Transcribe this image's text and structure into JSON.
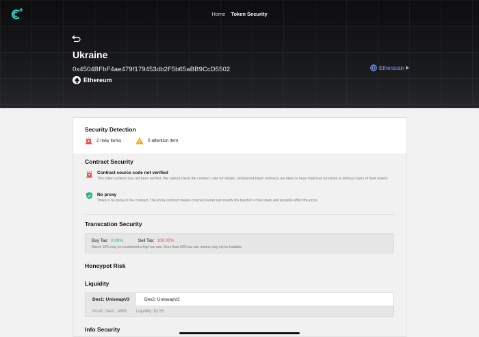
{
  "nav": {
    "home": "Home",
    "token_security": "Token Security"
  },
  "token": {
    "name": "Ukraine",
    "address": "0x4504BFbF4ae479f179453db2F5b65aBB9CcD5502",
    "chain": "Ethereum",
    "explorer_link": "Etherscan"
  },
  "security_detection": {
    "title": "Security Detection",
    "risky": "2 risky items",
    "attention": "0 attention item"
  },
  "contract_security": {
    "title": "Contract Security",
    "items": [
      {
        "title": "Contract source code not verified",
        "desc": "This token contract has not been verified. We cannot check the contract code for details. Unsourced token contracts are likely to have malicious functions to defraud users of their assets.",
        "status": "risky"
      },
      {
        "title": "No proxy",
        "desc": "There is no proxy in the contract. The proxy contract means contract owner can modify the function of the token and possibly effect the price.",
        "status": "safe"
      }
    ]
  },
  "transaction_security": {
    "title": "Transcation Security",
    "buy_label": "Buy Tax:",
    "buy_value": "0.00%",
    "sell_label": "Sell Tax:",
    "sell_value": "100.00%",
    "note": "Above 10% may be considered a high tax rate. More than 50% tax rate means may not be tradable."
  },
  "honeypot": {
    "title": "Honeypot Risk"
  },
  "liquidity": {
    "title": "Liquidity",
    "tabs": [
      "Dex1: UniswapV3",
      "Dex2: UniswapV2"
    ],
    "pool": "Pool1:  0xe2...4958",
    "liquidity": "Liquidity:  $2.55"
  },
  "info_security": {
    "title": "Info Security"
  },
  "colors": {
    "safe": "#1fb67a",
    "risky": "#e8504a",
    "warning": "#f5a623",
    "link": "#7fa8ff"
  }
}
